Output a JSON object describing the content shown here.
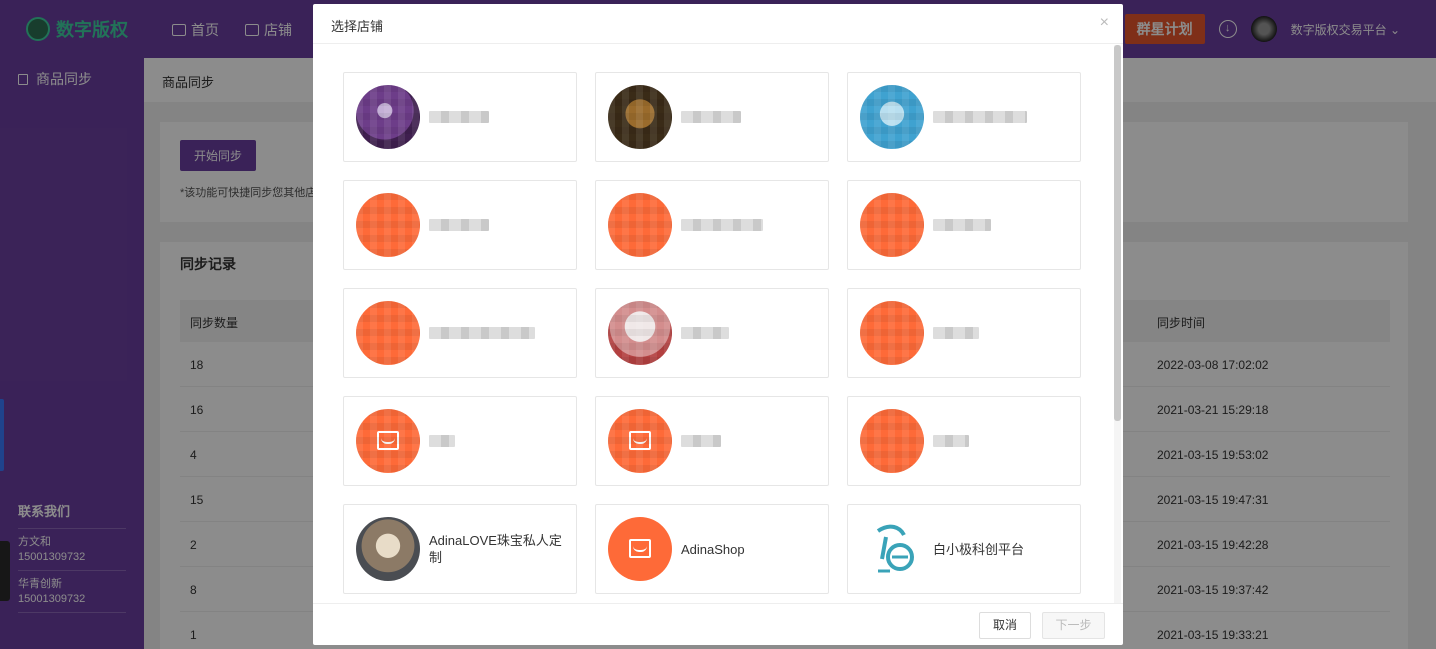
{
  "header": {
    "logo_text": "数字版权",
    "nav": [
      {
        "label": "首页",
        "icon": "home-icon"
      },
      {
        "label": "店铺",
        "icon": "store-icon"
      }
    ],
    "plan_button": "群星计划",
    "platform_label": "数字版权交易平台",
    "dropdown_glyph": "⌄"
  },
  "sidebar": {
    "active_item": "商品同步",
    "contact_title": "联系我们",
    "contacts": [
      {
        "name": "方文和",
        "phone": "15001309732"
      },
      {
        "name": "华青创新",
        "phone": "15001309732"
      }
    ]
  },
  "main": {
    "breadcrumb": "商品同步",
    "sync_button": "开始同步",
    "note": "*该功能可快捷同步您其他店",
    "records_title": "同步记录",
    "columns": [
      "同步数量",
      "同步时间"
    ],
    "rows": [
      {
        "count": "18",
        "time": "2022-03-08 17:02:02"
      },
      {
        "count": "16",
        "time": "2021-03-21 15:29:18"
      },
      {
        "count": "4",
        "time": "2021-03-15 19:53:02"
      },
      {
        "count": "15",
        "time": "2021-03-15 19:47:31"
      },
      {
        "count": "2",
        "time": "2021-03-15 19:42:28"
      },
      {
        "count": "8",
        "time": "2021-03-15 19:37:42"
      },
      {
        "count": "1",
        "time": "2021-03-15 19:33:21"
      }
    ]
  },
  "modal": {
    "title": "选择店铺",
    "close_glyph": "×",
    "visible_shops": [
      {
        "name": "AdinaLOVE珠宝私人定制",
        "logo": "cat-photo"
      },
      {
        "name": "AdinaShop",
        "logo": "orange-store"
      },
      {
        "name": "白小极科创平台",
        "logo": "baixiao-logo"
      }
    ],
    "cancel_button": "取消",
    "next_button": "下一步"
  }
}
